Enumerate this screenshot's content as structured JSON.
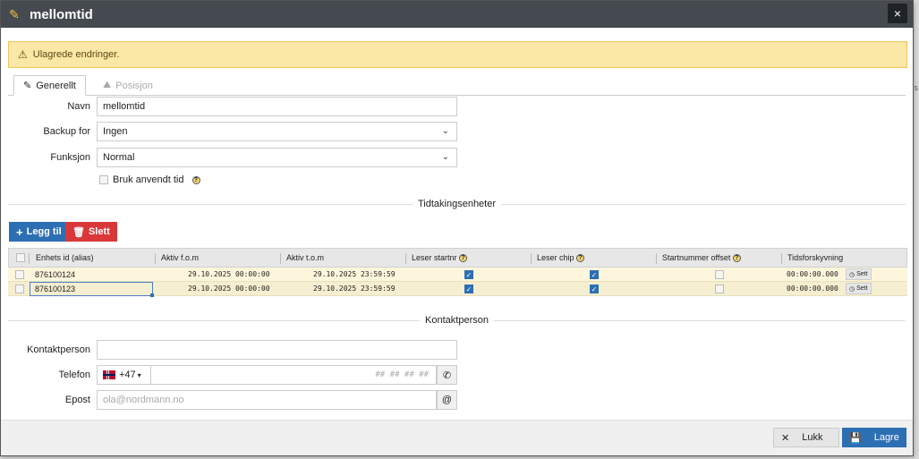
{
  "window": {
    "title": "mellomtid",
    "close_label": "×"
  },
  "alert": {
    "text": "Ulagrede endringer."
  },
  "tabs": [
    {
      "label": "Generellt"
    },
    {
      "label": "Posisjon"
    }
  ],
  "form": {
    "name_label": "Navn",
    "name_value": "mellomtid",
    "backup_label": "Backup for",
    "backup_value": "Ingen",
    "function_label": "Funksjon",
    "function_value": "Normal",
    "use_time_label": "Bruk anvendt tid"
  },
  "units_section": {
    "title": "Tidtakingsenheter",
    "add_label": "Legg til",
    "delete_label": "Slett"
  },
  "grid": {
    "columns": [
      "Enhets id (alias)",
      "Aktiv f.o.m",
      "Aktiv t.o.m",
      "Leser startnr",
      "Leser chip",
      "Startnummer offset",
      "Tidsforskyvning"
    ],
    "rows": [
      {
        "id": "876100124",
        "from": "29.10.2025 00:00:00",
        "to": "29.10.2025 23:59:59",
        "start_nr": true,
        "chip": true,
        "offset": false,
        "shift": "00:00:00.000",
        "set_label": "Sett"
      },
      {
        "id": "876100123",
        "from": "29.10.2025 00:00:00",
        "to": "29.10.2025 23:59:59",
        "start_nr": true,
        "chip": true,
        "offset": false,
        "shift": "00:00:00.000",
        "set_label": "Sett"
      }
    ]
  },
  "contact_section": {
    "title": "Kontaktperson",
    "person_label": "Kontaktperson",
    "person_value": "",
    "phone_label": "Telefon",
    "phone_prefix": "+47",
    "phone_placeholder": "## ## ## ##",
    "email_label": "Epost",
    "email_placeholder": "ola@nordmann.no"
  },
  "footer": {
    "close_label": "Lukk",
    "save_label": "Lagre"
  },
  "colors": {
    "primary": "#2d6fb3",
    "danger": "#d9383a",
    "warning_bg": "#fbe7a6",
    "title_bar": "#454a50"
  }
}
